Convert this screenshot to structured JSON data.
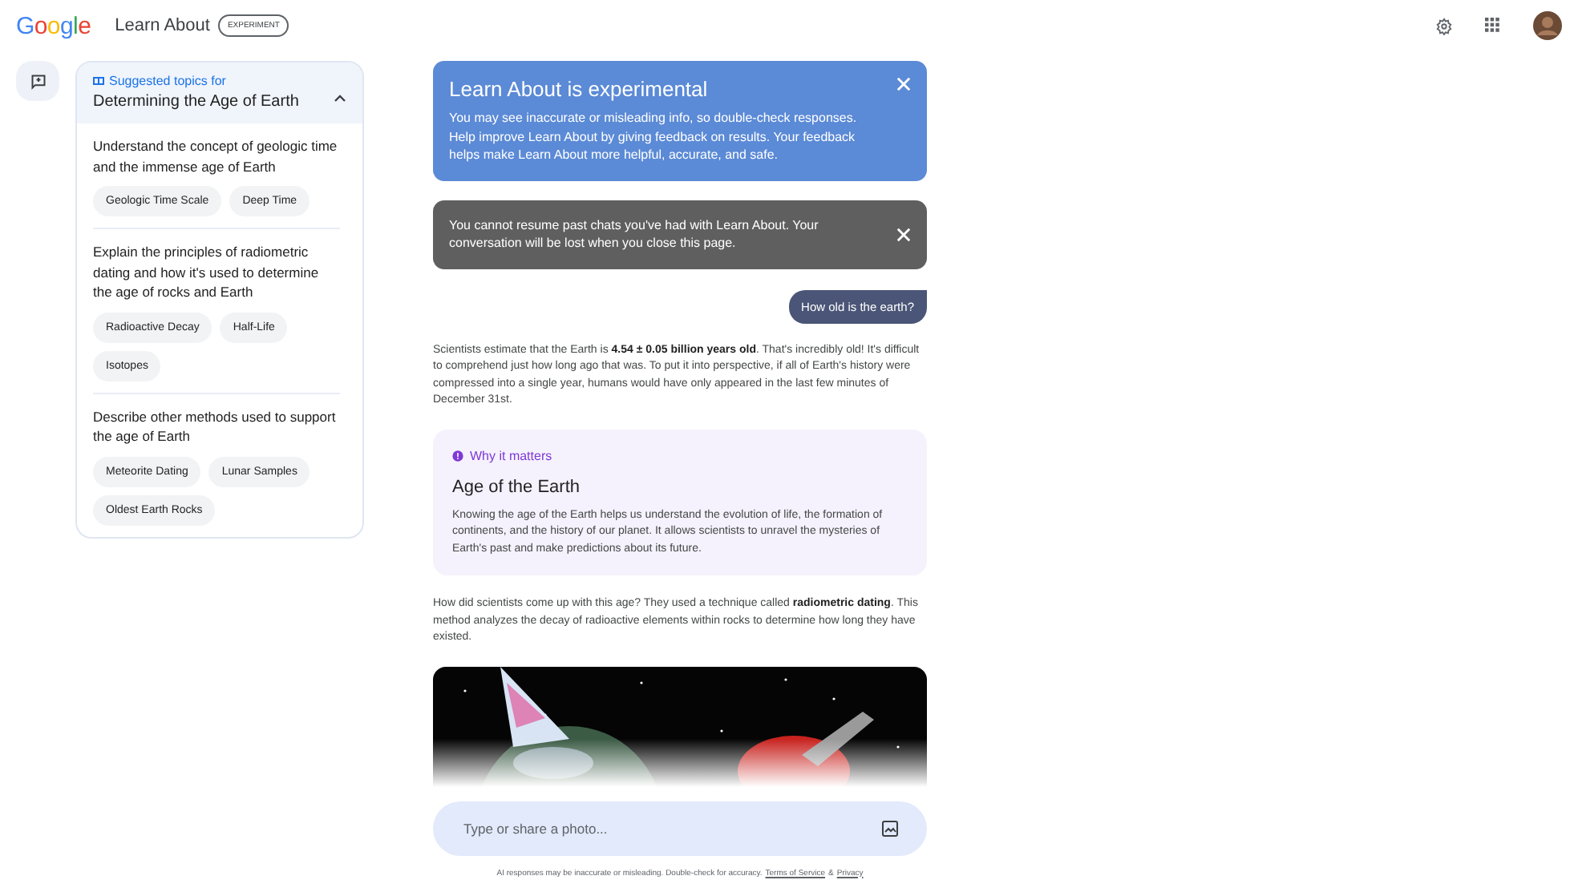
{
  "header": {
    "logo": "Google",
    "title": "Learn About",
    "badge": "EXPERIMENT"
  },
  "sidebar": {
    "label": "Suggested topics for",
    "title": "Determining the Age of Earth",
    "expanded": true,
    "sections": [
      {
        "heading": "Understand the concept of geologic time and the immense age of Earth",
        "chips": [
          "Geologic Time Scale",
          "Deep Time"
        ]
      },
      {
        "heading": "Explain the principles of radiometric dating and how it's used to determine the age of rocks and Earth",
        "chips": [
          "Radioactive Decay",
          "Half-Life",
          "Isotopes"
        ]
      },
      {
        "heading": "Describe other methods used to support the age of Earth",
        "chips": [
          "Meteorite Dating",
          "Lunar Samples",
          "Oldest Earth Rocks"
        ]
      }
    ]
  },
  "notices": [
    {
      "kind": "info",
      "title": "Learn About is experimental",
      "body": "You may see inaccurate or misleading info, so double-check responses. Help improve Learn About by giving feedback on results. Your feedback helps make Learn About more helpful, accurate, and safe."
    },
    {
      "kind": "warning",
      "body": "You cannot resume past chats you've had with Learn About. Your conversation will be lost when you close this page."
    }
  ],
  "chat": {
    "user_message": "How old is the earth?",
    "answer": "Scientists estimate that the Earth is **4.54 ± 0.05 billion years old**. That's incredibly old! It's difficult to comprehend just how long ago that was. To put it into perspective, if all of Earth's history were compressed into a single year, humans would have only appeared in the last few minutes of December 31st.",
    "why_card": {
      "label": "Why it matters",
      "title": "Age of the Earth",
      "body": "Knowing the age of the Earth helps us understand the evolution of life, the formation of continents, and the history of our planet. It allows scientists to unravel the mysteries of Earth's past and make predictions about its future."
    },
    "follow_up": "How did scientists come up with this age? They used a technique called **radiometric dating**. This method analyzes the decay of radioactive elements within rocks to determine how long they have existed."
  },
  "composer": {
    "placeholder": "Type or share a photo..."
  },
  "footer": {
    "text": "AI responses may be inaccurate or misleading. Double-check for accuracy.",
    "links": [
      "Terms of Service",
      "Privacy"
    ],
    "separator": "&"
  }
}
